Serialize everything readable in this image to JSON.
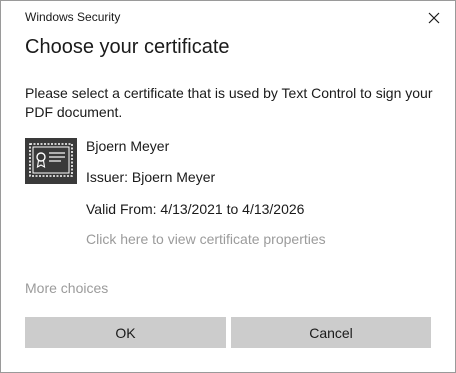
{
  "window": {
    "title": "Windows Security"
  },
  "dialog": {
    "heading": "Choose your certificate",
    "description": "Please select a certificate that is used by Text Control to sign your PDF document."
  },
  "certificate": {
    "icon": "certificate-icon",
    "name": "Bjoern Meyer",
    "issuer": "Issuer: Bjoern Meyer",
    "valid": "Valid From: 4/13/2021 to 4/13/2026",
    "properties_link": "Click here to view certificate properties"
  },
  "more_choices": "More choices",
  "buttons": {
    "ok": "OK",
    "cancel": "Cancel"
  }
}
